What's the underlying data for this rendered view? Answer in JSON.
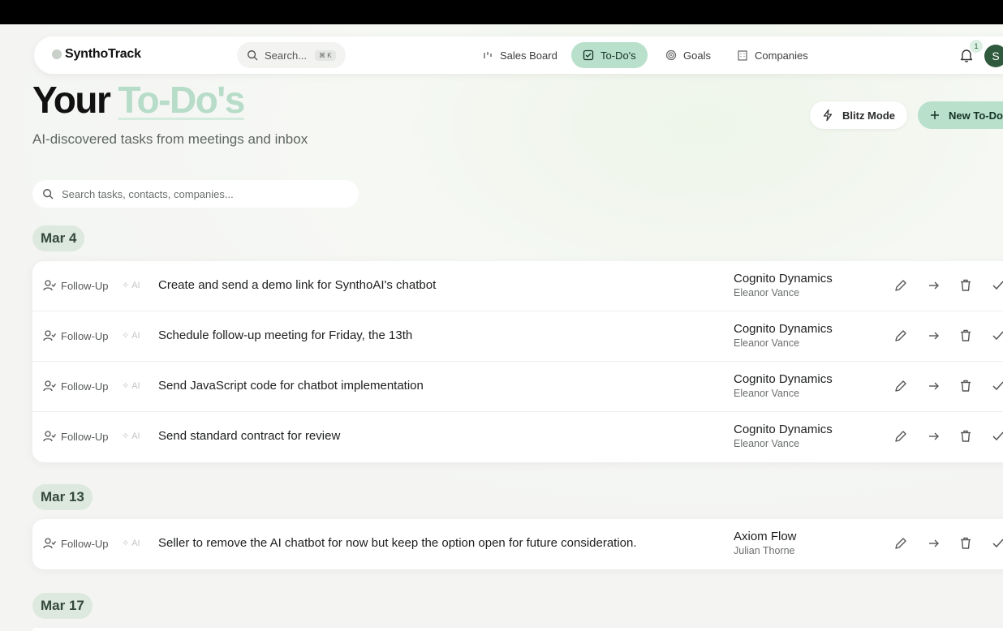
{
  "app": {
    "name": "SynthoTrack"
  },
  "nav": {
    "search_placeholder": "Search...",
    "search_shortcut": "⌘ K",
    "items": [
      {
        "label": "Sales Board",
        "icon": "bar-chart-icon",
        "active": false
      },
      {
        "label": "To-Do's",
        "icon": "checkbox-icon",
        "active": true
      },
      {
        "label": "Goals",
        "icon": "target-icon",
        "active": false
      },
      {
        "label": "Companies",
        "icon": "building-icon",
        "active": false
      }
    ],
    "notifications_count": "1",
    "avatar_initial": "S"
  },
  "header": {
    "title_prefix": "Your",
    "title_highlight": "To-Do's",
    "subtitle": "AI-discovered tasks from meetings and inbox",
    "blitz_label": "Blitz Mode",
    "new_label": "New To-Do"
  },
  "task_search": {
    "placeholder": "Search tasks, contacts, companies..."
  },
  "groups": [
    {
      "date": "Mar 4",
      "tasks": [
        {
          "type": "Follow-Up",
          "ai": "AI",
          "title": "Create and send a demo link for SynthoAI's chatbot",
          "company": "Cognito Dynamics",
          "contact": "Eleanor Vance"
        },
        {
          "type": "Follow-Up",
          "ai": "AI",
          "title": "Schedule follow-up meeting for Friday, the 13th",
          "company": "Cognito Dynamics",
          "contact": "Eleanor Vance"
        },
        {
          "type": "Follow-Up",
          "ai": "AI",
          "title": "Send JavaScript code for chatbot implementation",
          "company": "Cognito Dynamics",
          "contact": "Eleanor Vance"
        },
        {
          "type": "Follow-Up",
          "ai": "AI",
          "title": "Send standard contract for review",
          "company": "Cognito Dynamics",
          "contact": "Eleanor Vance"
        }
      ]
    },
    {
      "date": "Mar 13",
      "tasks": [
        {
          "type": "Follow-Up",
          "ai": "AI",
          "title": "Seller to remove the AI chatbot for now but keep the option open for future consideration.",
          "company": "Axiom Flow",
          "contact": "Julian Thorne"
        }
      ]
    },
    {
      "date": "Mar 17",
      "tasks": []
    }
  ],
  "colors": {
    "accent": "#b8e0cb",
    "accent_text": "#173324",
    "date_pill": "#dde8de"
  }
}
